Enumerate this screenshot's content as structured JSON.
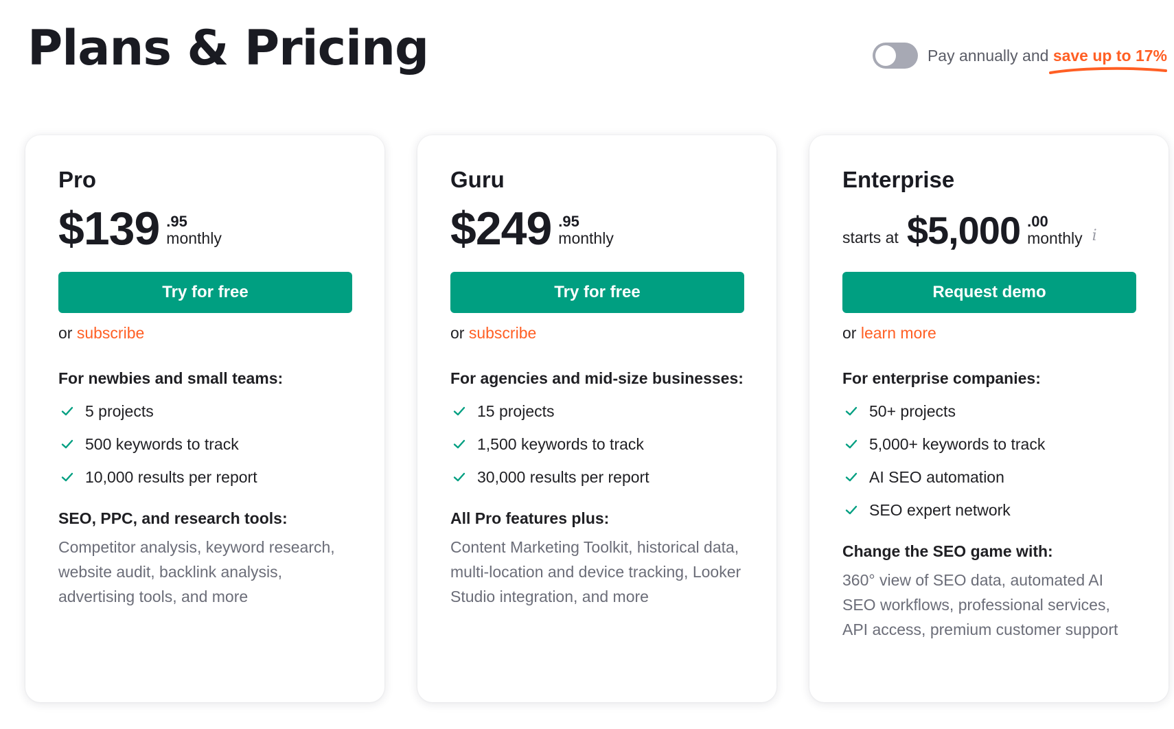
{
  "header": {
    "title": "Plans & Pricing",
    "billing_text": "Pay annually and",
    "billing_save": "save up to 17%",
    "toggle_on": false
  },
  "colors": {
    "accent_green": "#009f81",
    "link_orange": "#ff5f24",
    "toggle_off": "#a7a9b4"
  },
  "plans": [
    {
      "name": "Pro",
      "price_prefix": "",
      "price_main": "$139",
      "price_cents": ".95",
      "price_period": "monthly",
      "cta": "Try for free",
      "alt_prefix": "or",
      "alt_link": "subscribe",
      "audience": "For newbies and small teams:",
      "features": [
        "5 projects",
        "500 keywords to track",
        "10,000 results per report"
      ],
      "tools_title": "SEO, PPC, and research tools:",
      "tools_desc": "Competitor analysis, keyword research, website audit, backlink analysis, advertising tools, and more"
    },
    {
      "name": "Guru",
      "price_prefix": "",
      "price_main": "$249",
      "price_cents": ".95",
      "price_period": "monthly",
      "cta": "Try for free",
      "alt_prefix": "or",
      "alt_link": "subscribe",
      "audience": "For agencies and mid-size businesses:",
      "features": [
        "15 projects",
        "1,500 keywords to track",
        "30,000 results per report"
      ],
      "tools_title": "All Pro features plus:",
      "tools_desc": "Content Marketing Toolkit, historical data, multi-location and device tracking, Looker Studio integration, and more"
    },
    {
      "name": "Enterprise",
      "price_prefix": "starts at",
      "price_main": "$5,000",
      "price_cents": ".00",
      "price_period": "monthly",
      "cta": "Request demo",
      "alt_prefix": "or",
      "alt_link": "learn more",
      "audience": "For enterprise companies:",
      "features": [
        "50+ projects",
        "5,000+ keywords to track",
        "AI SEO automation",
        "SEO expert network"
      ],
      "tools_title": "Change the SEO game with:",
      "tools_desc": "360° view of SEO data, automated AI SEO workflows, professional services, API access, premium customer support"
    }
  ]
}
